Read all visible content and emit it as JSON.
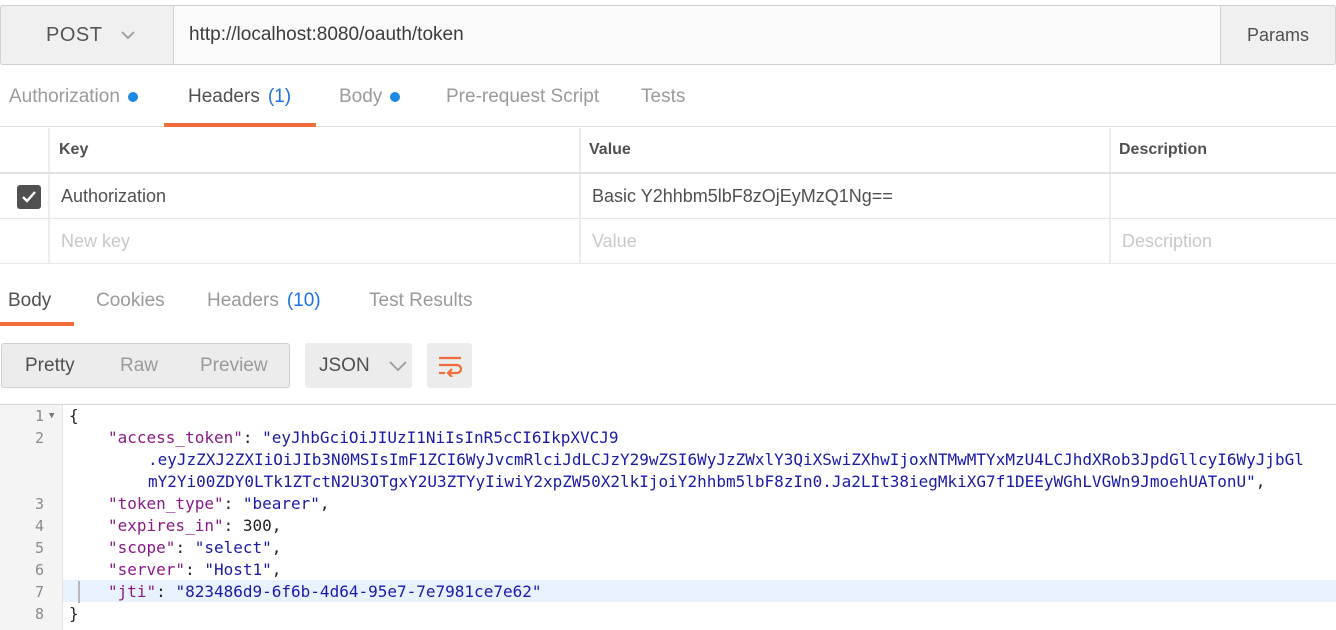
{
  "request": {
    "method": "POST",
    "url": "http://localhost:8080/oauth/token",
    "params_label": "Params"
  },
  "request_tabs": {
    "authorization": "Authorization",
    "headers": "Headers",
    "headers_count": "(1)",
    "body": "Body",
    "prerequest": "Pre-request Script",
    "tests": "Tests"
  },
  "headers_table": {
    "col_key": "Key",
    "col_value": "Value",
    "col_description": "Description",
    "rows": [
      {
        "key": "Authorization",
        "value": "Basic Y2hhbm5lbF8zOjEyMzQ1Ng==",
        "description": ""
      }
    ],
    "placeholder_key": "New key",
    "placeholder_value": "Value",
    "placeholder_description": "Description"
  },
  "response_tabs": {
    "body": "Body",
    "cookies": "Cookies",
    "headers": "Headers",
    "headers_count": "(10)",
    "test_results": "Test Results"
  },
  "response_toolbar": {
    "pretty": "Pretty",
    "raw": "Raw",
    "preview": "Preview",
    "format": "JSON"
  },
  "response_body": {
    "lines": [
      {
        "n": "1",
        "text": "{"
      },
      {
        "n": "2",
        "key": "\"access_token\"",
        "value": "\"eyJhbGciOiJIUzI1NiIsInR5cCI6IkpXVCJ9",
        "cont1": ".eyJzZXJ2ZXIiOiJIb3N0MSIsImF1ZCI6WyJvcmRlciJdLCJzY29wZSI6WyJzZWxlY3QiXSwiZXhwIjoxNTMwMTYxMzU4LCJhdXRob3JpdGllcyI6WyJjbGl",
        "cont2": "mY2Yi00ZDY0LTk1ZTctN2U3OTgxY2U3ZTYyIiwiY2xpZW50X2lkIjoiY2hhbm5lbF8zIn0.Ja2LIt38iegMkiXG7f1DEEyWGhLVGWn9JmoehUATonU\""
      },
      {
        "n": "3",
        "key": "\"token_type\"",
        "value": "\"bearer\""
      },
      {
        "n": "4",
        "key": "\"expires_in\"",
        "value": "300"
      },
      {
        "n": "5",
        "key": "\"scope\"",
        "value": "\"select\""
      },
      {
        "n": "6",
        "key": "\"server\"",
        "value": "\"Host1\""
      },
      {
        "n": "7",
        "key": "\"jti\"",
        "value": "\"823486d9-6f6b-4d64-95e7-7e7981ce7e62\""
      },
      {
        "n": "8",
        "text": "}"
      }
    ]
  },
  "colors": {
    "accent": "#f26b3a",
    "link_blue": "#1a73e8",
    "json_key": "#8a1a8a",
    "json_string": "#1a1aa6"
  }
}
